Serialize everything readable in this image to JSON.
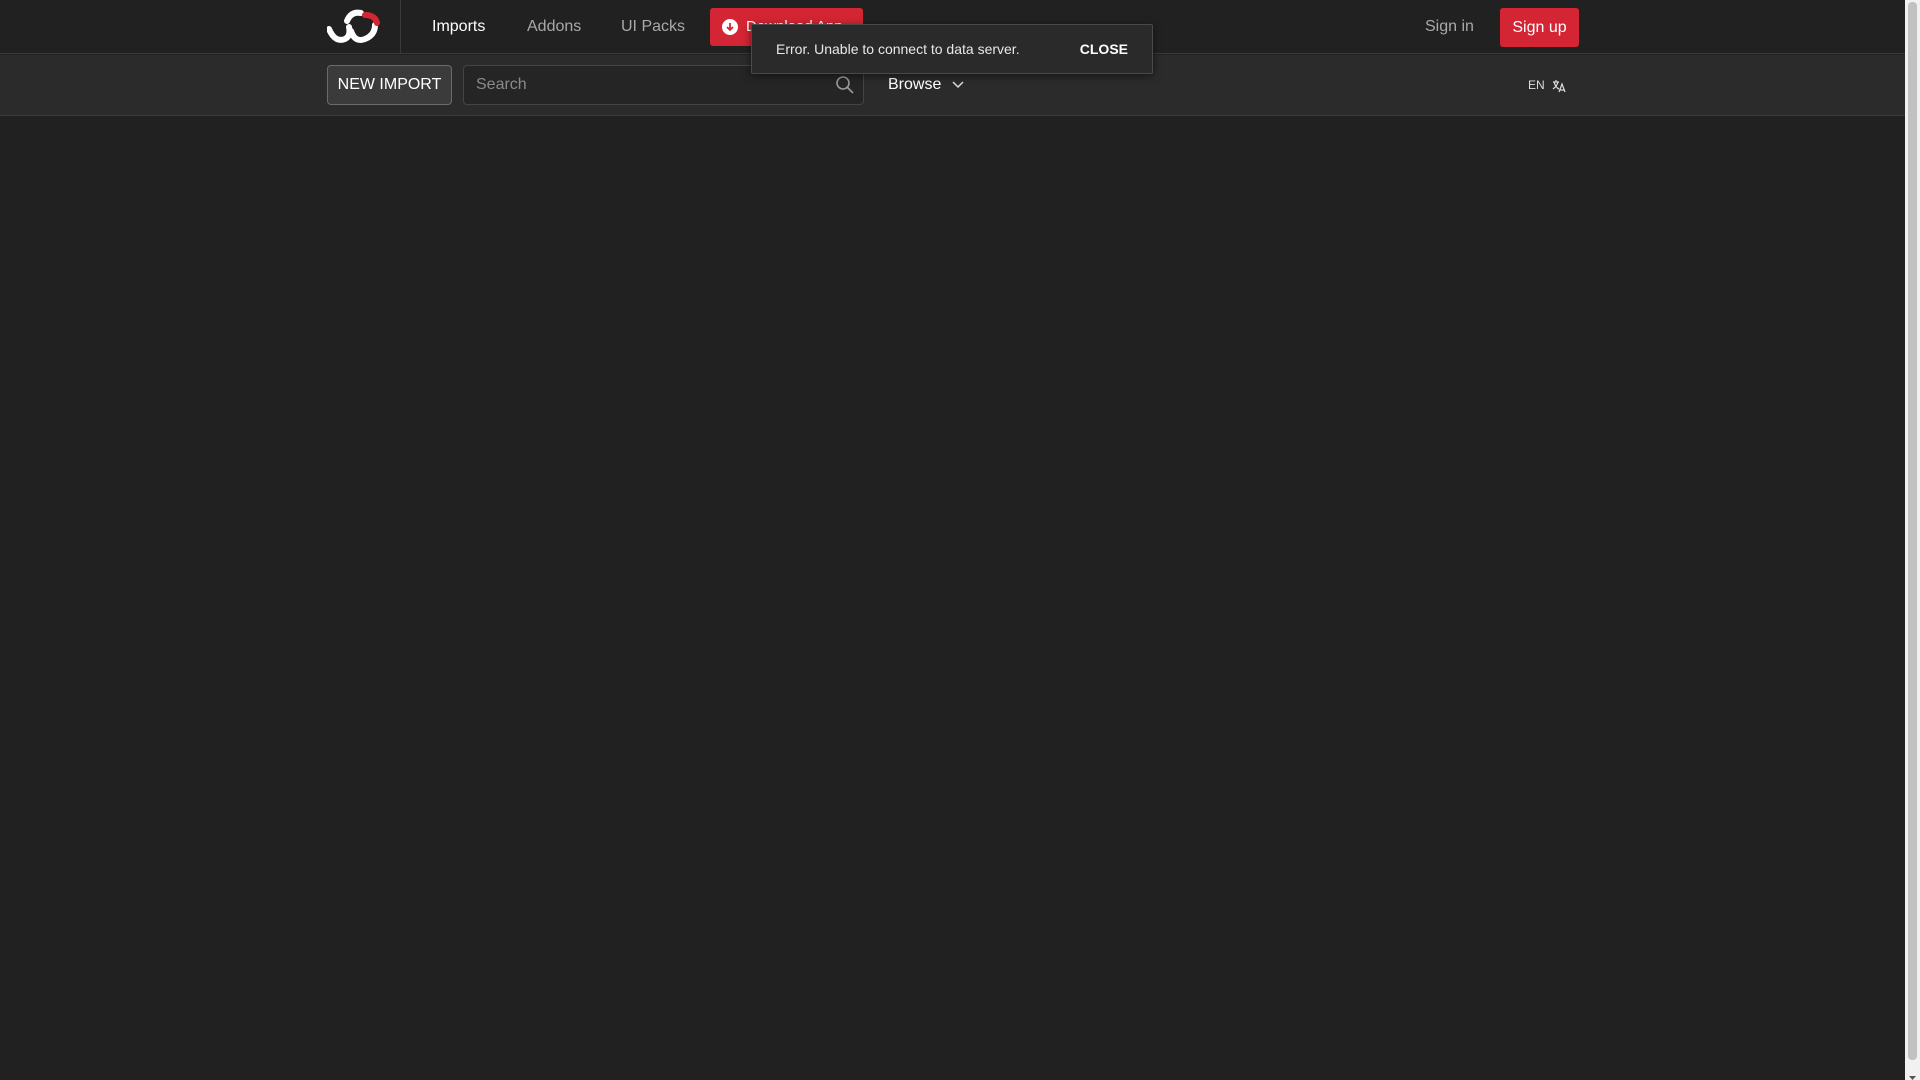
{
  "nav": {
    "logo_icon": "brand-logo-icon",
    "links": [
      "Imports",
      "Addons",
      "UI Packs"
    ],
    "active": "Imports",
    "download_label": "Download App",
    "signin_label": "Sign in",
    "signup_label": "Sign up",
    "accent_color": "#d32533"
  },
  "subbar": {
    "new_import_label": "NEW IMPORT",
    "search_placeholder": "Search",
    "search_value": "",
    "browse_label": "Browse",
    "lang_label": "EN"
  },
  "toast": {
    "message": "Error. Unable to connect to data server.",
    "close_label": "CLOSE"
  }
}
